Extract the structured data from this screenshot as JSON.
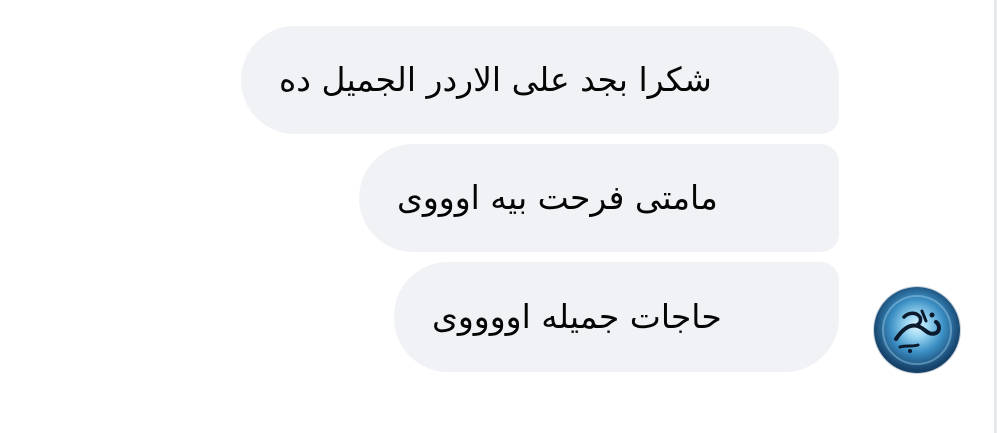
{
  "conversation": {
    "messages": [
      {
        "text": "شكرا بجد على الاردر الجميل ده"
      },
      {
        "text": "مامتى فرحت بيه اوووى"
      },
      {
        "text": "حاجات جميله اووووى"
      }
    ]
  },
  "sender": {
    "avatar_icon": "calligraphy-avatar-icon"
  },
  "colors": {
    "bubble_background": "#f0f2f5",
    "text": "#050505",
    "page_background": "#ffffff"
  }
}
